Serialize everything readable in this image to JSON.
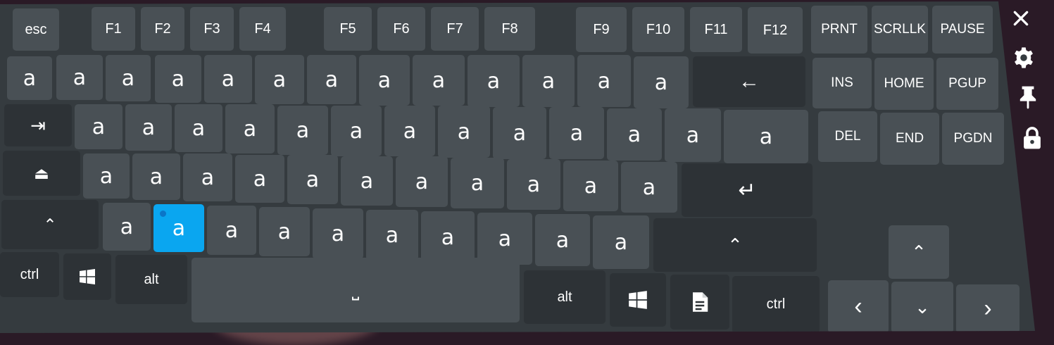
{
  "keyboard": {
    "function_row": {
      "esc": "esc",
      "f_keys": [
        "F1",
        "F2",
        "F3",
        "F4",
        "F5",
        "F6",
        "F7",
        "F8",
        "F9",
        "F10",
        "F11",
        "F12"
      ],
      "prnt": "PRNT",
      "scrllk": "SCRLLK",
      "pause": "PAUSE"
    },
    "letter_char": "a",
    "backspace_symbol": "←",
    "tab_symbol": "⇥",
    "capslock_symbol": "⏏",
    "enter_symbol": "↵",
    "shift_symbol": "⌃",
    "space_symbol": "⎵",
    "bottom_row": {
      "ctrl_left": "ctrl",
      "alt_left": "alt",
      "alt_right": "alt",
      "ctrl_right": "ctrl"
    },
    "nav_cluster": {
      "ins": "INS",
      "home": "HOME",
      "pgup": "PGUP",
      "del": "DEL",
      "end": "END",
      "pgdn": "PGDN"
    },
    "arrows": {
      "up": "⌃",
      "left": "‹",
      "down": "⌄",
      "right": "›"
    },
    "selected_key": "row4-key2"
  },
  "side_toolbar": {
    "icons": [
      "close-icon",
      "gear-icon",
      "pin-icon",
      "lock-icon"
    ]
  },
  "colors": {
    "panel": "#353b3f",
    "key": "#495055",
    "key_dark": "#2d3236",
    "selected": "#0aa6f0"
  }
}
